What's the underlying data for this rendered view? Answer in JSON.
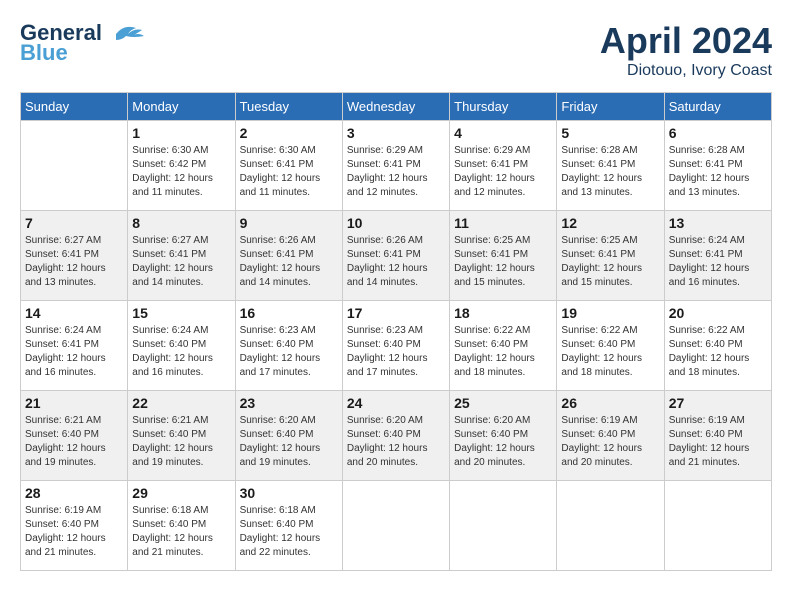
{
  "header": {
    "logo_line1": "General",
    "logo_line2": "Blue",
    "month": "April 2024",
    "location": "Diotouo, Ivory Coast"
  },
  "days_of_week": [
    "Sunday",
    "Monday",
    "Tuesday",
    "Wednesday",
    "Thursday",
    "Friday",
    "Saturday"
  ],
  "weeks": [
    [
      {
        "day": "",
        "info": ""
      },
      {
        "day": "1",
        "info": "Sunrise: 6:30 AM\nSunset: 6:42 PM\nDaylight: 12 hours\nand 11 minutes."
      },
      {
        "day": "2",
        "info": "Sunrise: 6:30 AM\nSunset: 6:41 PM\nDaylight: 12 hours\nand 11 minutes."
      },
      {
        "day": "3",
        "info": "Sunrise: 6:29 AM\nSunset: 6:41 PM\nDaylight: 12 hours\nand 12 minutes."
      },
      {
        "day": "4",
        "info": "Sunrise: 6:29 AM\nSunset: 6:41 PM\nDaylight: 12 hours\nand 12 minutes."
      },
      {
        "day": "5",
        "info": "Sunrise: 6:28 AM\nSunset: 6:41 PM\nDaylight: 12 hours\nand 13 minutes."
      },
      {
        "day": "6",
        "info": "Sunrise: 6:28 AM\nSunset: 6:41 PM\nDaylight: 12 hours\nand 13 minutes."
      }
    ],
    [
      {
        "day": "7",
        "info": "Sunrise: 6:27 AM\nSunset: 6:41 PM\nDaylight: 12 hours\nand 13 minutes."
      },
      {
        "day": "8",
        "info": "Sunrise: 6:27 AM\nSunset: 6:41 PM\nDaylight: 12 hours\nand 14 minutes."
      },
      {
        "day": "9",
        "info": "Sunrise: 6:26 AM\nSunset: 6:41 PM\nDaylight: 12 hours\nand 14 minutes."
      },
      {
        "day": "10",
        "info": "Sunrise: 6:26 AM\nSunset: 6:41 PM\nDaylight: 12 hours\nand 14 minutes."
      },
      {
        "day": "11",
        "info": "Sunrise: 6:25 AM\nSunset: 6:41 PM\nDaylight: 12 hours\nand 15 minutes."
      },
      {
        "day": "12",
        "info": "Sunrise: 6:25 AM\nSunset: 6:41 PM\nDaylight: 12 hours\nand 15 minutes."
      },
      {
        "day": "13",
        "info": "Sunrise: 6:24 AM\nSunset: 6:41 PM\nDaylight: 12 hours\nand 16 minutes."
      }
    ],
    [
      {
        "day": "14",
        "info": "Sunrise: 6:24 AM\nSunset: 6:41 PM\nDaylight: 12 hours\nand 16 minutes."
      },
      {
        "day": "15",
        "info": "Sunrise: 6:24 AM\nSunset: 6:40 PM\nDaylight: 12 hours\nand 16 minutes."
      },
      {
        "day": "16",
        "info": "Sunrise: 6:23 AM\nSunset: 6:40 PM\nDaylight: 12 hours\nand 17 minutes."
      },
      {
        "day": "17",
        "info": "Sunrise: 6:23 AM\nSunset: 6:40 PM\nDaylight: 12 hours\nand 17 minutes."
      },
      {
        "day": "18",
        "info": "Sunrise: 6:22 AM\nSunset: 6:40 PM\nDaylight: 12 hours\nand 18 minutes."
      },
      {
        "day": "19",
        "info": "Sunrise: 6:22 AM\nSunset: 6:40 PM\nDaylight: 12 hours\nand 18 minutes."
      },
      {
        "day": "20",
        "info": "Sunrise: 6:22 AM\nSunset: 6:40 PM\nDaylight: 12 hours\nand 18 minutes."
      }
    ],
    [
      {
        "day": "21",
        "info": "Sunrise: 6:21 AM\nSunset: 6:40 PM\nDaylight: 12 hours\nand 19 minutes."
      },
      {
        "day": "22",
        "info": "Sunrise: 6:21 AM\nSunset: 6:40 PM\nDaylight: 12 hours\nand 19 minutes."
      },
      {
        "day": "23",
        "info": "Sunrise: 6:20 AM\nSunset: 6:40 PM\nDaylight: 12 hours\nand 19 minutes."
      },
      {
        "day": "24",
        "info": "Sunrise: 6:20 AM\nSunset: 6:40 PM\nDaylight: 12 hours\nand 20 minutes."
      },
      {
        "day": "25",
        "info": "Sunrise: 6:20 AM\nSunset: 6:40 PM\nDaylight: 12 hours\nand 20 minutes."
      },
      {
        "day": "26",
        "info": "Sunrise: 6:19 AM\nSunset: 6:40 PM\nDaylight: 12 hours\nand 20 minutes."
      },
      {
        "day": "27",
        "info": "Sunrise: 6:19 AM\nSunset: 6:40 PM\nDaylight: 12 hours\nand 21 minutes."
      }
    ],
    [
      {
        "day": "28",
        "info": "Sunrise: 6:19 AM\nSunset: 6:40 PM\nDaylight: 12 hours\nand 21 minutes."
      },
      {
        "day": "29",
        "info": "Sunrise: 6:18 AM\nSunset: 6:40 PM\nDaylight: 12 hours\nand 21 minutes."
      },
      {
        "day": "30",
        "info": "Sunrise: 6:18 AM\nSunset: 6:40 PM\nDaylight: 12 hours\nand 22 minutes."
      },
      {
        "day": "",
        "info": ""
      },
      {
        "day": "",
        "info": ""
      },
      {
        "day": "",
        "info": ""
      },
      {
        "day": "",
        "info": ""
      }
    ]
  ]
}
